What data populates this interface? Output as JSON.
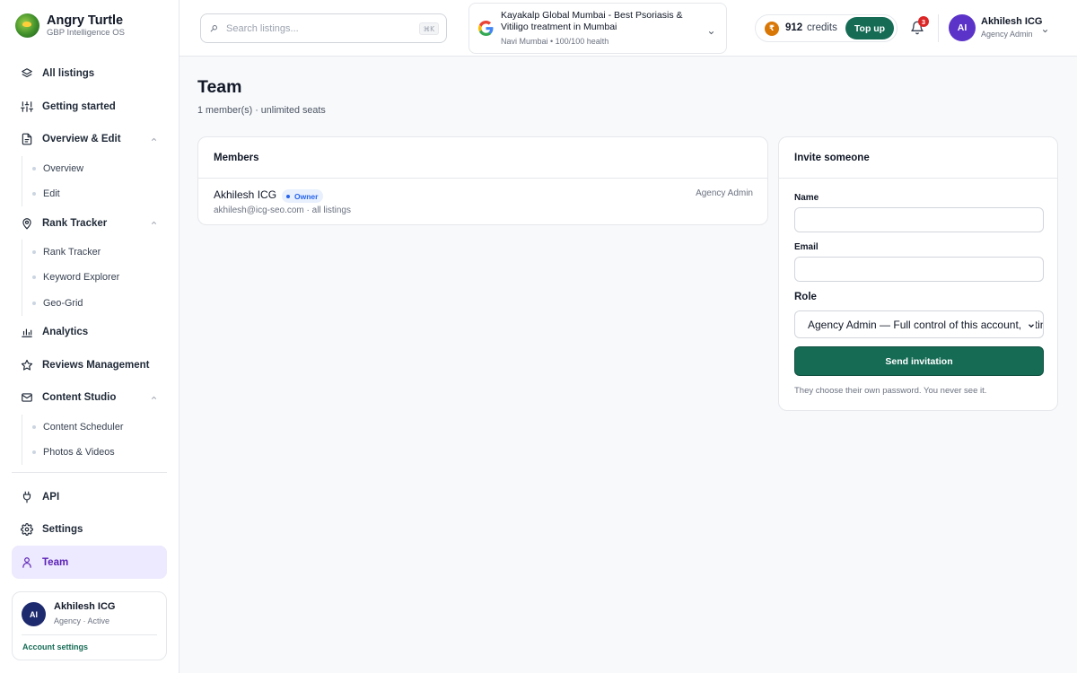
{
  "brand": {
    "name": "Angry Turtle",
    "subtitle": "GBP Intelligence OS"
  },
  "sidebar": {
    "items": [
      {
        "label": "All listings",
        "icon": "layers-icon"
      },
      {
        "label": "Getting started",
        "icon": "sliders-icon"
      },
      {
        "label": "Overview & Edit",
        "icon": "document-icon",
        "expanded": true,
        "children": [
          "Overview",
          "Edit"
        ]
      },
      {
        "label": "Rank Tracker",
        "icon": "map-pin-icon",
        "expanded": true,
        "children": [
          "Rank Tracker",
          "Keyword Explorer",
          "Geo-Grid"
        ]
      },
      {
        "label": "Analytics",
        "icon": "bar-chart-icon"
      },
      {
        "label": "Reviews Management",
        "icon": "star-icon"
      },
      {
        "label": "Content Studio",
        "icon": "mail-icon",
        "expanded": true,
        "children": [
          "Content Scheduler",
          "Photos & Videos"
        ]
      },
      {
        "label": "API",
        "icon": "plug-icon"
      },
      {
        "label": "Settings",
        "icon": "gear-icon"
      },
      {
        "label": "Team",
        "icon": "user-icon",
        "active": true
      }
    ],
    "user_card": {
      "initials": "AI",
      "name": "Akhilesh ICG",
      "role": "Agency · Active",
      "link": "Account settings"
    }
  },
  "header": {
    "search": {
      "placeholder": "Search listings...",
      "shortcut": "⌘K"
    },
    "listing": {
      "title": "Kayakalp Global Mumbai - Best Psoriasis & Vitiligo treatment in Mumbai",
      "subtitle": "Navi Mumbai • 100/100 health"
    },
    "credits": {
      "symbol": "₹",
      "amount": "912",
      "word": "credits",
      "topup_label": "Top up"
    },
    "notifications": {
      "count": "3"
    },
    "user": {
      "initials": "AI",
      "name": "Akhilesh ICG",
      "role": "Agency Admin"
    }
  },
  "main": {
    "title": "Team",
    "subtitle": "1 member(s) · unlimited seats",
    "members": {
      "heading": "Members",
      "rows": [
        {
          "name": "Akhilesh ICG",
          "badge": "Owner",
          "email": "akhilesh@icg-seo.com · all listings",
          "role": "Agency Admin"
        }
      ]
    },
    "invite": {
      "heading": "Invite someone",
      "name_label": "Name",
      "name_value": "",
      "email_label": "Email",
      "email_value": "",
      "role_label": "Role",
      "role_selected": "Agency Admin — Full control of this account, listings, billing",
      "send_label": "Send invitation",
      "hint": "They choose their own password. You never see it."
    }
  },
  "colors": {
    "accent": "#166b55",
    "active_nav_bg": "#ede9fe",
    "active_nav_text": "#5b21b6",
    "avatar": "#5b33c9"
  }
}
